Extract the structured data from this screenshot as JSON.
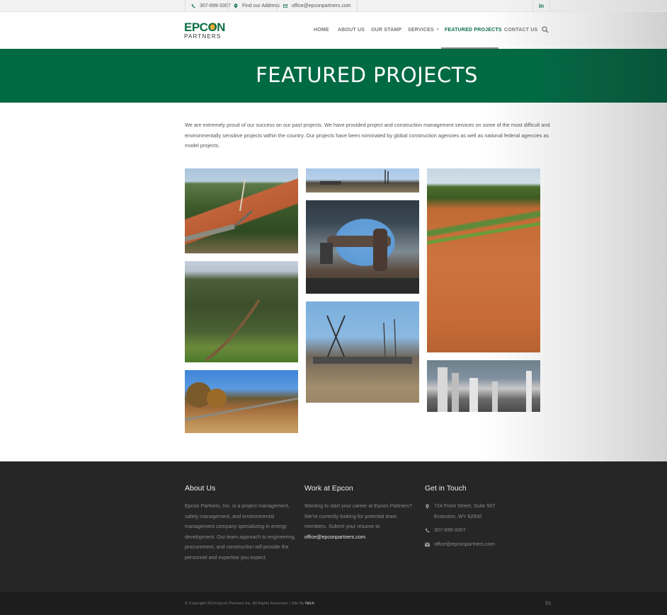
{
  "topbar": {
    "phone": "307-699-3307",
    "address_link": "Find our Address",
    "email": "office@epconpartners.com",
    "social": "in"
  },
  "brand": {
    "logo_top": "EPCON",
    "logo_bottom": "PARTNERS",
    "primary_color": "#006a45"
  },
  "nav": {
    "items": [
      {
        "label": "HOME"
      },
      {
        "label": "ABOUT US"
      },
      {
        "label": "OUR STAMP"
      },
      {
        "label": "SERVICES"
      },
      {
        "label": "FEATURED PROJECTS"
      },
      {
        "label": "CONTACT US"
      }
    ],
    "active": "FEATURED PROJECTS"
  },
  "banner": {
    "title": "FEATURED PROJECTS"
  },
  "intro": {
    "text": "We are extremely proud of our success on our past projects. We have provided project and construction management services on some of the most difficult and environmentally sensitive projects within the country. Our projects have been nominated by global construction agencies as well as national federal agencies as model projects."
  },
  "footer": {
    "about": {
      "heading": "About Us",
      "text": "Epcon Partners, Inc. is a project management, safety management, and environmental management company specializing in energy development. Our team approach to engineering, procurement, and construction will provide the personnel and expertise you expect."
    },
    "work": {
      "heading": "Work at Epcon",
      "text": "Wanting to start your career at Epcon Partners? We’re currently looking for potential team members. Submit your resume to",
      "email": "office@epconpartners.com",
      "end": "."
    },
    "contact": {
      "heading": "Get in Touch",
      "address_line1": "724 Front Street, Suite 507",
      "address_line2": "Evanston, WY 82930",
      "phone": "307-699-3307",
      "email": "office@epconpartners.com"
    },
    "copyright": "© Copyright 2014 Epcon Partners Inc. All Rights Reserved. | Site By",
    "credit": "Nitch",
    "social": "in"
  }
}
